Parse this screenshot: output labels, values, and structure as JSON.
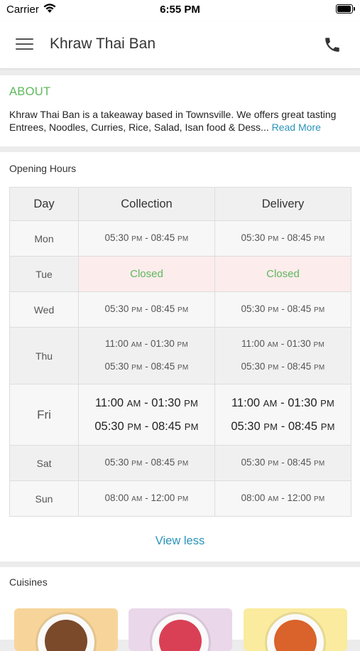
{
  "status_bar": {
    "carrier": "Carrier",
    "time": "6:55 PM"
  },
  "header": {
    "title": "Khraw Thai Ban",
    "menu_icon": "hamburger-menu-icon",
    "phone_icon": "phone-icon"
  },
  "about": {
    "heading": "ABOUT",
    "text": "Khraw Thai Ban  is a takeaway based in Townsville. We offers great tasting Entrees, Noodles, Curries, Rice, Salad, Isan food & Dess...",
    "read_more": "Read More"
  },
  "opening_hours": {
    "heading": "Opening Hours",
    "columns": [
      "Day",
      "Collection",
      "Delivery"
    ],
    "rows": [
      {
        "day": "Mon",
        "collection": [
          [
            "05:30",
            "PM",
            "08:45",
            "PM"
          ]
        ],
        "delivery": [
          [
            "05:30",
            "PM",
            "08:45",
            "PM"
          ]
        ]
      },
      {
        "day": "Tue",
        "collection_closed": "Closed",
        "delivery_closed": "Closed"
      },
      {
        "day": "Wed",
        "collection": [
          [
            "05:30",
            "PM",
            "08:45",
            "PM"
          ]
        ],
        "delivery": [
          [
            "05:30",
            "PM",
            "08:45",
            "PM"
          ]
        ]
      },
      {
        "day": "Thu",
        "collection": [
          [
            "11:00",
            "AM",
            "01:30",
            "PM"
          ],
          [
            "05:30",
            "PM",
            "08:45",
            "PM"
          ]
        ],
        "delivery": [
          [
            "11:00",
            "AM",
            "01:30",
            "PM"
          ],
          [
            "05:30",
            "PM",
            "08:45",
            "PM"
          ]
        ]
      },
      {
        "day": "Fri",
        "today": true,
        "collection": [
          [
            "11:00",
            "AM",
            "01:30",
            "PM"
          ],
          [
            "05:30",
            "PM",
            "08:45",
            "PM"
          ]
        ],
        "delivery": [
          [
            "11:00",
            "AM",
            "01:30",
            "PM"
          ],
          [
            "05:30",
            "PM",
            "08:45",
            "PM"
          ]
        ]
      },
      {
        "day": "Sat",
        "collection": [
          [
            "05:30",
            "PM",
            "08:45",
            "PM"
          ]
        ],
        "delivery": [
          [
            "05:30",
            "PM",
            "08:45",
            "PM"
          ]
        ]
      },
      {
        "day": "Sun",
        "collection": [
          [
            "08:00",
            "AM",
            "12:00",
            "PM"
          ]
        ],
        "delivery": [
          [
            "08:00",
            "AM",
            "12:00",
            "PM"
          ]
        ]
      }
    ],
    "view_less": "View less"
  },
  "cuisines": {
    "heading": "Cuisines",
    "tiles": [
      {
        "icon": "noodle-dish-image",
        "bg": "#f7d59a",
        "dish": "#7a4a2a"
      },
      {
        "icon": "dessert-dish-image",
        "bg": "#ead7ea",
        "dish": "#d94055"
      },
      {
        "icon": "pad-thai-dish-image",
        "bg": "#faeb9e",
        "dish": "#d9632a"
      }
    ]
  },
  "colors": {
    "accent_green": "#5cb85c",
    "link_blue": "#2a93b9",
    "closed_bg": "#fdecec"
  }
}
